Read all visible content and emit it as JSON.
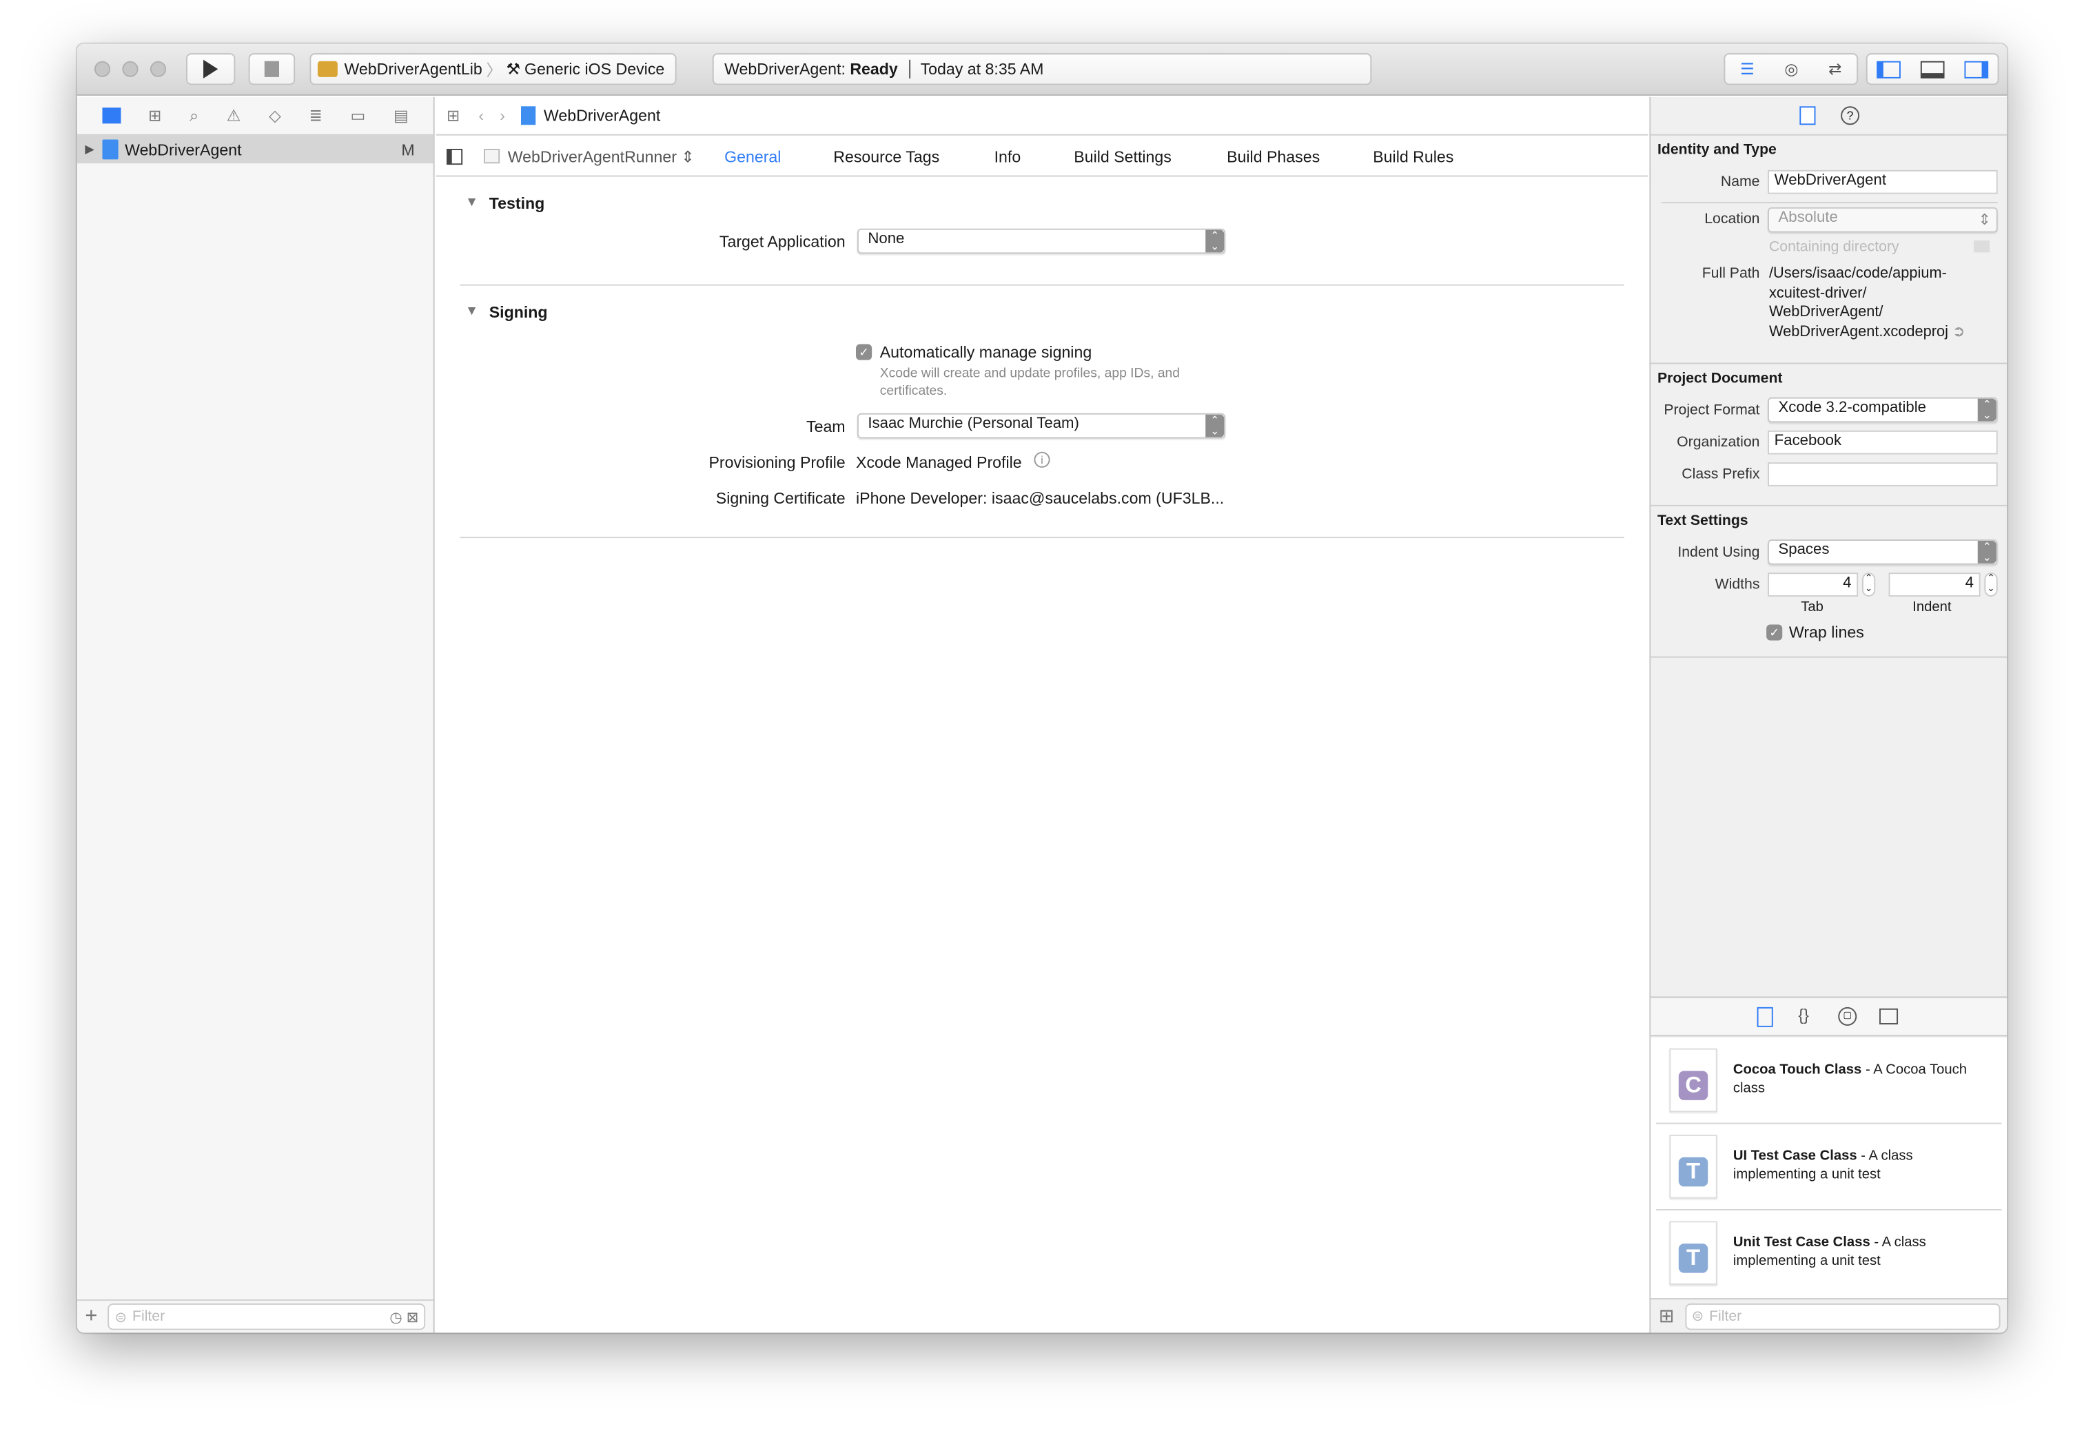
{
  "toolbar": {
    "scheme": "WebDriverAgentLib",
    "destination": "Generic iOS Device",
    "activity_project": "WebDriverAgent:",
    "activity_status": "Ready",
    "activity_time": "Today at 8:35 AM"
  },
  "navigator": {
    "items": [
      {
        "label": "WebDriverAgent",
        "badge": "M"
      }
    ],
    "filter_placeholder": "Filter"
  },
  "editor": {
    "jump_bar": {
      "file": "WebDriverAgent"
    },
    "target_selector": "WebDriverAgentRunner",
    "tabs": [
      "General",
      "Resource Tags",
      "Info",
      "Build Settings",
      "Build Phases",
      "Build Rules"
    ],
    "active_tab": "General",
    "testing": {
      "title": "Testing",
      "target_application_label": "Target Application",
      "target_application_value": "None"
    },
    "signing": {
      "title": "Signing",
      "auto_manage_label": "Automatically manage signing",
      "auto_manage_checked": true,
      "auto_manage_help": "Xcode will create and update profiles, app IDs, and certificates.",
      "team_label": "Team",
      "team_value": "Isaac Murchie (Personal Team)",
      "profile_label": "Provisioning Profile",
      "profile_value": "Xcode Managed Profile",
      "certificate_label": "Signing Certificate",
      "certificate_value": "iPhone Developer: isaac@saucelabs.com (UF3LB..."
    }
  },
  "inspector": {
    "identity": {
      "title": "Identity and Type",
      "name_label": "Name",
      "name_value": "WebDriverAgent",
      "location_label": "Location",
      "location_value": "Absolute",
      "containing_directory": "Containing directory",
      "full_path_label": "Full Path",
      "full_path_lines": [
        "/Users/isaac/code/appium-",
        "xcuitest-driver/",
        "WebDriverAgent/",
        "WebDriverAgent.xcodeproj"
      ]
    },
    "project_document": {
      "title": "Project Document",
      "format_label": "Project Format",
      "format_value": "Xcode 3.2-compatible",
      "organization_label": "Organization",
      "organization_value": "Facebook",
      "class_prefix_label": "Class Prefix",
      "class_prefix_value": ""
    },
    "text_settings": {
      "title": "Text Settings",
      "indent_label": "Indent Using",
      "indent_value": "Spaces",
      "widths_label": "Widths",
      "tab_width": "4",
      "indent_width": "4",
      "tab_caption": "Tab",
      "indent_caption": "Indent",
      "wrap_lines_label": "Wrap lines",
      "wrap_lines_checked": true
    }
  },
  "library": {
    "templates": [
      {
        "name": "Cocoa Touch Class",
        "desc": " - A Cocoa Touch class",
        "letter": "C",
        "color": "#a593c4"
      },
      {
        "name": "UI Test Case Class",
        "desc": " - A class implementing a unit test",
        "letter": "T",
        "color": "#8aabd6"
      },
      {
        "name": "Unit Test Case Class",
        "desc": " - A class implementing a unit test",
        "letter": "T",
        "color": "#8aabd6"
      }
    ],
    "filter_placeholder": "Filter"
  },
  "colors": {
    "accent": "#2f7cf6",
    "selection": "#d5d5d5"
  }
}
